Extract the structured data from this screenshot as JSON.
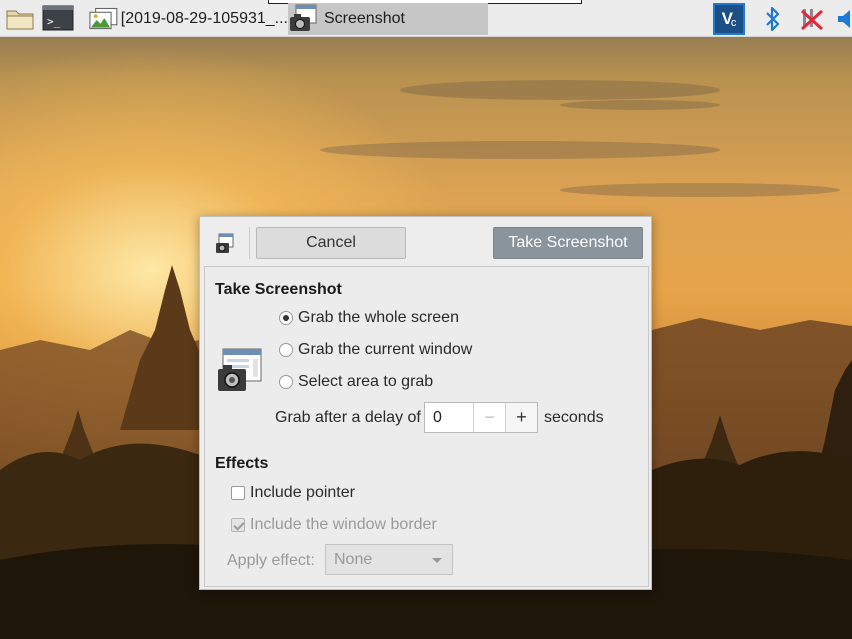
{
  "taskbar": {
    "launchers": [
      {
        "icon": "folder-icon"
      },
      {
        "icon": "terminal-icon"
      }
    ],
    "tasks": [
      {
        "label": "[2019-08-29-105931_...",
        "icon": "image-viewer-icon",
        "active": false
      },
      {
        "label": "Screenshot",
        "icon": "camera-icon",
        "active": true
      }
    ],
    "tray": [
      {
        "icon": "vnc-icon"
      },
      {
        "icon": "bluetooth-icon"
      },
      {
        "icon": "network-disconnected-icon"
      },
      {
        "icon": "volume-icon"
      }
    ]
  },
  "dialog": {
    "cancel_label": "Cancel",
    "take_label": "Take Screenshot",
    "section_title": "Take Screenshot",
    "options": [
      {
        "label": "Grab the whole screen",
        "selected": true
      },
      {
        "label": "Grab the current window",
        "selected": false
      },
      {
        "label": "Select area to grab",
        "selected": false
      }
    ],
    "delay_label": "Grab after a delay of",
    "delay_value": "0",
    "delay_unit": "seconds",
    "effects_title": "Effects",
    "include_pointer": {
      "label": "Include pointer",
      "checked": false,
      "enabled": true
    },
    "include_border": {
      "label": "Include the window border",
      "checked": true,
      "enabled": false
    },
    "apply_effect_label": "Apply effect:",
    "apply_effect_value": "None"
  },
  "colors": {
    "take_button_bg": "#8a949c",
    "accent_tray": "#1f7ad6",
    "network_x": "#e0283a"
  }
}
